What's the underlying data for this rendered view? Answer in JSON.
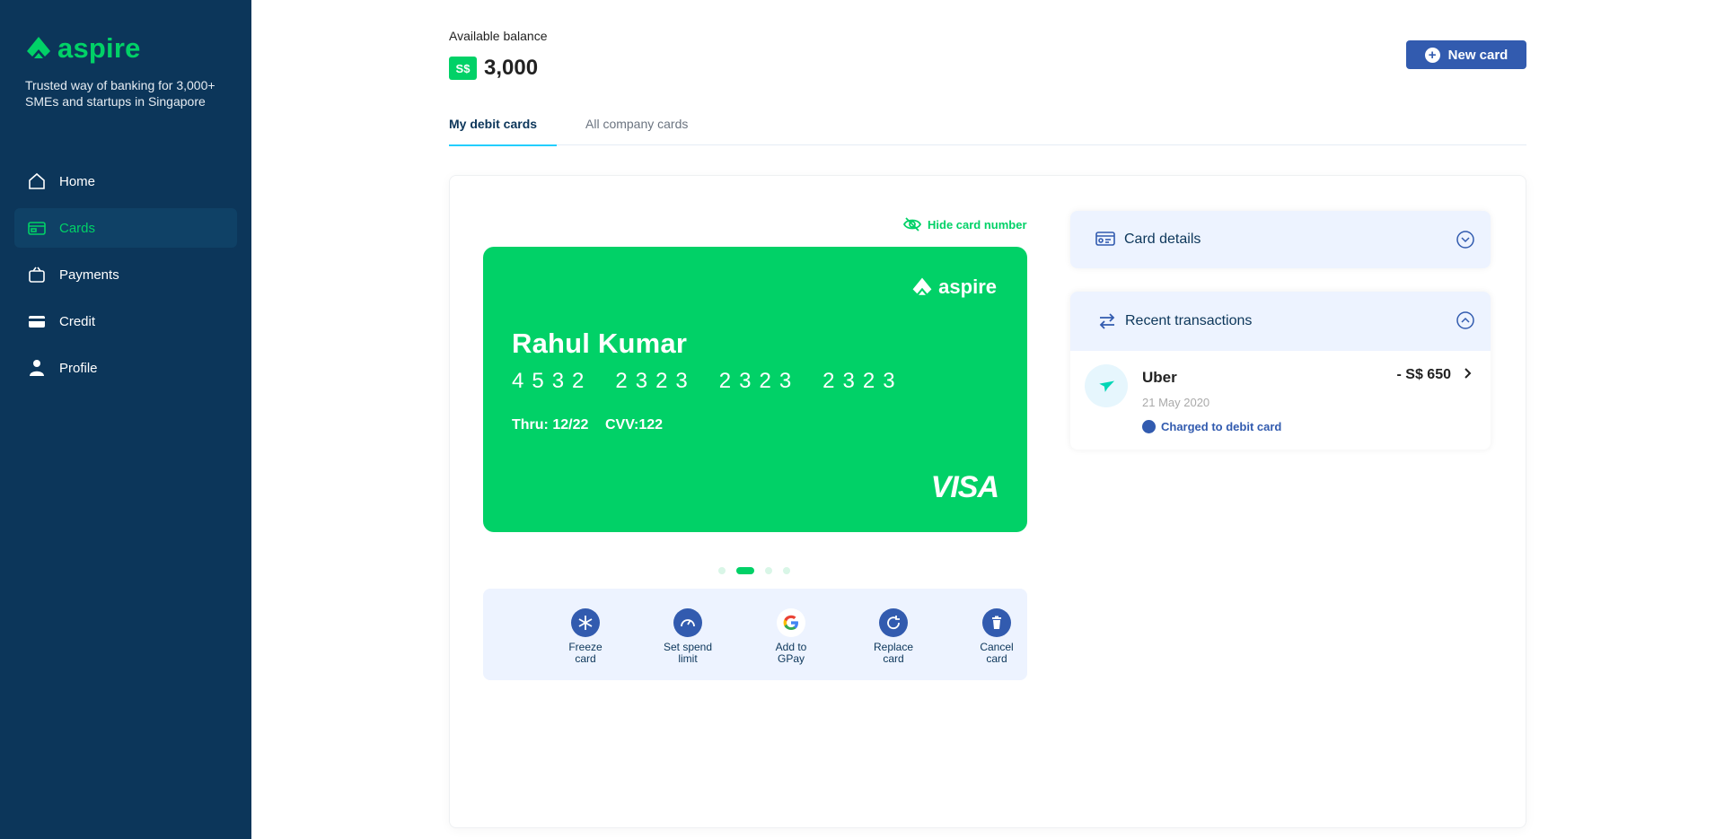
{
  "brand": {
    "name": "aspire",
    "tagline": "Trusted way of banking for 3,000+ SMEs and startups in Singapore",
    "accent_color": "#01d167",
    "sidebar_color": "#0c365a"
  },
  "sidebar": {
    "items": [
      {
        "label": "Home",
        "icon": "home-icon",
        "active": false
      },
      {
        "label": "Cards",
        "icon": "card-icon",
        "active": true
      },
      {
        "label": "Payments",
        "icon": "payments-icon",
        "active": false
      },
      {
        "label": "Credit",
        "icon": "credit-icon",
        "active": false
      },
      {
        "label": "Profile",
        "icon": "profile-icon",
        "active": false
      }
    ]
  },
  "header": {
    "balance_label": "Available balance",
    "currency": "S$",
    "balance": "3,000",
    "new_card_label": "New card"
  },
  "tabs": [
    {
      "label": "My debit cards",
      "active": true
    },
    {
      "label": "All company cards",
      "active": false
    }
  ],
  "card": {
    "hide_label": "Hide card number",
    "brand": "aspire",
    "holder": "Rahul Kumar",
    "number_groups": [
      "4532",
      "2323",
      "2323",
      "2323"
    ],
    "thru": "Thru: 12/22",
    "cvv": "CVV:122",
    "network": "VISA",
    "color": "#01d167",
    "carousel": {
      "count": 4,
      "active_index": 1
    }
  },
  "actions": [
    {
      "label": "Freeze\ncard",
      "icon": "freeze-icon"
    },
    {
      "label": "Set spend\nlimit",
      "icon": "speedometer-icon"
    },
    {
      "label": "Add to\nGPay",
      "icon": "google-icon"
    },
    {
      "label": "Replace\ncard",
      "icon": "replace-icon"
    },
    {
      "label": "Cancel\ncard",
      "icon": "trash-icon"
    }
  ],
  "card_details": {
    "title": "Card details",
    "expanded": false
  },
  "recent": {
    "title": "Recent transactions",
    "expanded": true,
    "transactions": [
      {
        "merchant": "Uber",
        "date": "21 May 2020",
        "charge_label": "Charged to debit card",
        "amount": "- S$ 650",
        "icon": "plane-icon"
      }
    ]
  }
}
